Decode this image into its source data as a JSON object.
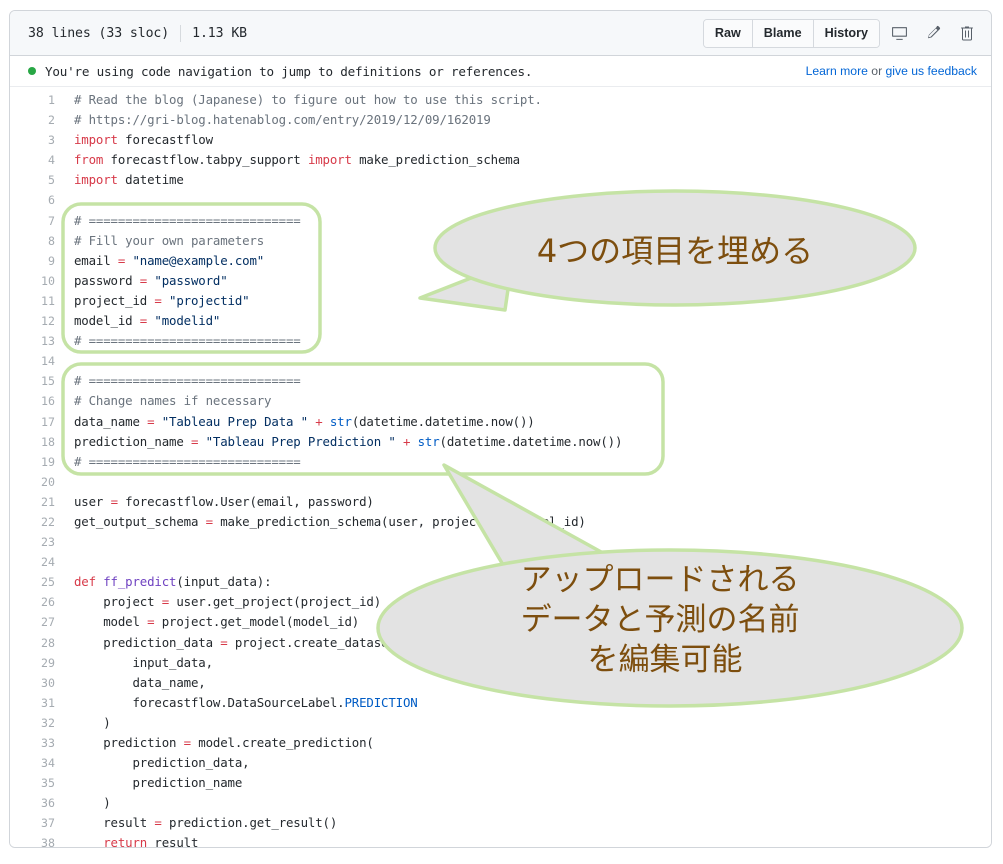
{
  "header": {
    "lines_info": "38 lines (33 sloc)",
    "size": "1.13 KB",
    "buttons": [
      {
        "label": "Raw",
        "name": "raw-button"
      },
      {
        "label": "Blame",
        "name": "blame-button"
      },
      {
        "label": "History",
        "name": "history-button"
      }
    ],
    "icons": [
      {
        "name": "desktop-icon"
      },
      {
        "name": "pencil-icon"
      },
      {
        "name": "trash-icon"
      }
    ]
  },
  "notice": {
    "text": "You're using code navigation to jump to definitions or references.",
    "learn_more": "Learn more",
    "conjunction": " or ",
    "feedback": "give us feedback",
    "dot_color": "#28a745"
  },
  "code": {
    "lines": [
      {
        "n": "1",
        "tokens": [
          {
            "t": "# Read the blog (Japanese) to figure out how to use this script.",
            "c": "t-com"
          }
        ]
      },
      {
        "n": "2",
        "tokens": [
          {
            "t": "# https://gri-blog.hatenablog.com/entry/2019/12/09/162019",
            "c": "t-com"
          }
        ]
      },
      {
        "n": "3",
        "tokens": [
          {
            "t": "import",
            "c": "t-kw"
          },
          {
            "t": " forecastflow",
            "c": ""
          }
        ]
      },
      {
        "n": "4",
        "tokens": [
          {
            "t": "from",
            "c": "t-kw"
          },
          {
            "t": " forecastflow.tabpy_support ",
            "c": ""
          },
          {
            "t": "import",
            "c": "t-kw"
          },
          {
            "t": " make_prediction_schema",
            "c": ""
          }
        ]
      },
      {
        "n": "5",
        "tokens": [
          {
            "t": "import",
            "c": "t-kw"
          },
          {
            "t": " datetime",
            "c": ""
          }
        ]
      },
      {
        "n": "6",
        "tokens": []
      },
      {
        "n": "7",
        "tokens": [
          {
            "t": "# =============================",
            "c": "t-com"
          }
        ]
      },
      {
        "n": "8",
        "tokens": [
          {
            "t": "# Fill your own parameters",
            "c": "t-com"
          }
        ]
      },
      {
        "n": "9",
        "tokens": [
          {
            "t": "email ",
            "c": ""
          },
          {
            "t": "=",
            "c": "t-op"
          },
          {
            "t": " ",
            "c": ""
          },
          {
            "t": "\"name@example.com\"",
            "c": "t-str"
          }
        ]
      },
      {
        "n": "10",
        "tokens": [
          {
            "t": "password ",
            "c": ""
          },
          {
            "t": "=",
            "c": "t-op"
          },
          {
            "t": " ",
            "c": ""
          },
          {
            "t": "\"password\"",
            "c": "t-str"
          }
        ]
      },
      {
        "n": "11",
        "tokens": [
          {
            "t": "project_id ",
            "c": ""
          },
          {
            "t": "=",
            "c": "t-op"
          },
          {
            "t": " ",
            "c": ""
          },
          {
            "t": "\"projectid\"",
            "c": "t-str"
          }
        ]
      },
      {
        "n": "12",
        "tokens": [
          {
            "t": "model_id ",
            "c": ""
          },
          {
            "t": "=",
            "c": "t-op"
          },
          {
            "t": " ",
            "c": ""
          },
          {
            "t": "\"modelid\"",
            "c": "t-str"
          }
        ]
      },
      {
        "n": "13",
        "tokens": [
          {
            "t": "# =============================",
            "c": "t-com"
          }
        ]
      },
      {
        "n": "14",
        "tokens": []
      },
      {
        "n": "15",
        "tokens": [
          {
            "t": "# =============================",
            "c": "t-com"
          }
        ]
      },
      {
        "n": "16",
        "tokens": [
          {
            "t": "# Change names if necessary",
            "c": "t-com"
          }
        ]
      },
      {
        "n": "17",
        "tokens": [
          {
            "t": "data_name ",
            "c": ""
          },
          {
            "t": "=",
            "c": "t-op"
          },
          {
            "t": " ",
            "c": ""
          },
          {
            "t": "\"Tableau Prep Data \"",
            "c": "t-str"
          },
          {
            "t": " ",
            "c": ""
          },
          {
            "t": "+",
            "c": "t-op"
          },
          {
            "t": " ",
            "c": ""
          },
          {
            "t": "str",
            "c": "t-cst"
          },
          {
            "t": "(datetime.datetime.now())",
            "c": ""
          }
        ]
      },
      {
        "n": "18",
        "tokens": [
          {
            "t": "prediction_name ",
            "c": ""
          },
          {
            "t": "=",
            "c": "t-op"
          },
          {
            "t": " ",
            "c": ""
          },
          {
            "t": "\"Tableau Prep Prediction \"",
            "c": "t-str"
          },
          {
            "t": " ",
            "c": ""
          },
          {
            "t": "+",
            "c": "t-op"
          },
          {
            "t": " ",
            "c": ""
          },
          {
            "t": "str",
            "c": "t-cst"
          },
          {
            "t": "(datetime.datetime.now())",
            "c": ""
          }
        ]
      },
      {
        "n": "19",
        "tokens": [
          {
            "t": "# =============================",
            "c": "t-com"
          }
        ]
      },
      {
        "n": "20",
        "tokens": []
      },
      {
        "n": "21",
        "tokens": [
          {
            "t": "user ",
            "c": ""
          },
          {
            "t": "=",
            "c": "t-op"
          },
          {
            "t": " forecastflow.User(email, password)",
            "c": ""
          }
        ]
      },
      {
        "n": "22",
        "tokens": [
          {
            "t": "get_output_schema ",
            "c": ""
          },
          {
            "t": "=",
            "c": "t-op"
          },
          {
            "t": " make_prediction_schema(user, project_id, model_id)",
            "c": ""
          }
        ]
      },
      {
        "n": "23",
        "tokens": []
      },
      {
        "n": "24",
        "tokens": []
      },
      {
        "n": "25",
        "tokens": [
          {
            "t": "def",
            "c": "t-kw"
          },
          {
            "t": " ",
            "c": ""
          },
          {
            "t": "ff_predict",
            "c": "t-fn"
          },
          {
            "t": "(input_data):",
            "c": ""
          }
        ]
      },
      {
        "n": "26",
        "tokens": [
          {
            "t": "    project ",
            "c": ""
          },
          {
            "t": "=",
            "c": "t-op"
          },
          {
            "t": " user.get_project(project_id)",
            "c": ""
          }
        ]
      },
      {
        "n": "27",
        "tokens": [
          {
            "t": "    model ",
            "c": ""
          },
          {
            "t": "=",
            "c": "t-op"
          },
          {
            "t": " project.get_model(model_id)",
            "c": ""
          }
        ]
      },
      {
        "n": "28",
        "tokens": [
          {
            "t": "    prediction_data ",
            "c": ""
          },
          {
            "t": "=",
            "c": "t-op"
          },
          {
            "t": " project.create_datasource(",
            "c": ""
          }
        ]
      },
      {
        "n": "29",
        "tokens": [
          {
            "t": "        input_data,",
            "c": ""
          }
        ]
      },
      {
        "n": "30",
        "tokens": [
          {
            "t": "        data_name,",
            "c": ""
          }
        ]
      },
      {
        "n": "31",
        "tokens": [
          {
            "t": "        forecastflow.DataSourceLabel.",
            "c": ""
          },
          {
            "t": "PREDICTION",
            "c": "t-cst"
          }
        ]
      },
      {
        "n": "32",
        "tokens": [
          {
            "t": "    )",
            "c": ""
          }
        ]
      },
      {
        "n": "33",
        "tokens": [
          {
            "t": "    prediction ",
            "c": ""
          },
          {
            "t": "=",
            "c": "t-op"
          },
          {
            "t": " model.create_prediction(",
            "c": ""
          }
        ]
      },
      {
        "n": "34",
        "tokens": [
          {
            "t": "        prediction_data,",
            "c": ""
          }
        ]
      },
      {
        "n": "35",
        "tokens": [
          {
            "t": "        prediction_name",
            "c": ""
          }
        ]
      },
      {
        "n": "36",
        "tokens": [
          {
            "t": "    )",
            "c": ""
          }
        ]
      },
      {
        "n": "37",
        "tokens": [
          {
            "t": "    result ",
            "c": ""
          },
          {
            "t": "=",
            "c": "t-op"
          },
          {
            "t": " prediction.get_result()",
            "c": ""
          }
        ]
      },
      {
        "n": "38",
        "tokens": [
          {
            "t": "    ",
            "c": ""
          },
          {
            "t": "return",
            "c": "t-kw"
          },
          {
            "t": " result",
            "c": ""
          }
        ]
      }
    ]
  },
  "annotations": {
    "highlight_color": "#c5e3a5",
    "balloon_fill": "#e3e3e3",
    "text_color": "#7d4e0e",
    "callout_1": {
      "text": "4つの項目を埋める"
    },
    "callout_2": {
      "line1": "アップロードされる",
      "line2": "データと予測の名前",
      "line3": "を編集可能"
    }
  }
}
